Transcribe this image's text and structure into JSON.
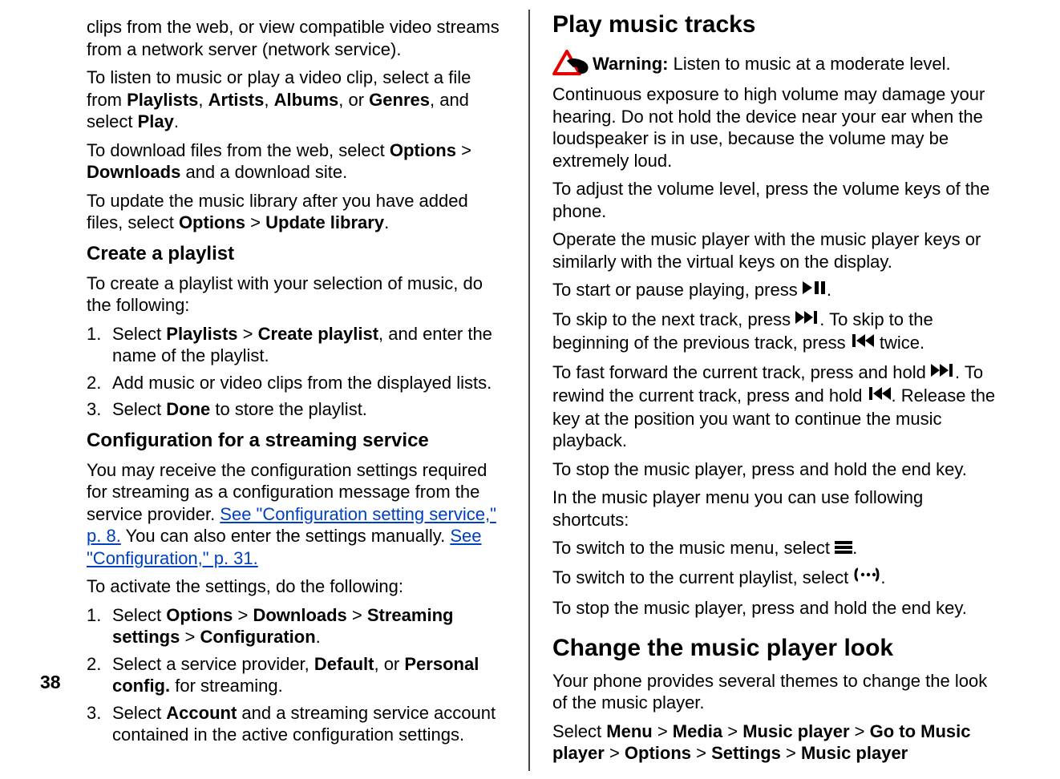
{
  "page_number": "38",
  "left": {
    "intro": "clips from the web, or view compatible video streams from a network server (network service).",
    "listen_prefix": "To listen to music or play a video clip, select a file from ",
    "playlists": "Playlists",
    "comma1": ", ",
    "artists": "Artists",
    "comma2": ", ",
    "albums": "Albums",
    "comma3": ", or ",
    "genres": "Genres",
    "listen_suffix1": ", and select ",
    "play": "Play",
    "period": ".",
    "download_prefix": "To download files from the web, select ",
    "options": "Options",
    "gt": " > ",
    "downloads": "Downloads",
    "download_suffix": " and a download site.",
    "update_prefix": "To update the music library after you have added files, select ",
    "update_library": "Update library",
    "h_create": "Create a playlist",
    "create_intro": "To create a playlist with your selection of music, do the following:",
    "li1_num": "1.",
    "li1_select": "Select ",
    "li1_create_playlist": "Create playlist",
    "li1_suffix": ", and enter the name of the playlist.",
    "li2_num": "2.",
    "li2": "Add music or video clips from the displayed lists.",
    "li3_num": "3.",
    "li3_select": "Select ",
    "li3_done": "Done",
    "li3_suffix": " to store the playlist.",
    "h_config": "Configuration for a streaming service",
    "config_p1_pre": "You may receive the configuration settings required for streaming as a configuration message from the service provider. ",
    "config_link1": "See \"Configuration setting service,\" p. 8.",
    "config_p1_mid": " You can also enter the settings manually. ",
    "config_link2": "See \"Configuration,\" p. 31.",
    "activate_intro": "To activate the settings, do the following:",
    "a_li1_num": "1.",
    "a_li1_select": "Select ",
    "a_li1_streaming": "Streaming settings",
    "a_li1_configuration": "Configuration",
    "a_li2_num": "2.",
    "a_li2_pre": "Select a service provider, ",
    "a_li2_default": "Default",
    "a_li2_or": ", or ",
    "a_li2_personal": "Personal config.",
    "a_li2_suffix": " for streaming.",
    "a_li3_num": "3.",
    "a_li3_select": "Select ",
    "a_li3_account": "Account",
    "a_li3_suffix": " and a streaming service account contained in the active configuration settings."
  },
  "right": {
    "h_play": "Play music tracks",
    "warning_label": "Warning:",
    "warning_text": "  Listen to music at a moderate level. Continuous exposure to high volume may damage your hearing. Do not hold the device near your ear when the loudspeaker is in use, because the volume may be extremely loud.",
    "adjust_vol": "To adjust the volume level, press the volume keys of the phone.",
    "operate": "Operate the music player with the music player keys or similarly with the virtual keys on the display.",
    "start_pause_pre": "To start or pause playing, press ",
    "start_pause_suf": ".",
    "skip_next_pre": "To skip to the next track, press ",
    "skip_next_mid": ". To skip to the beginning of the previous track, press ",
    "skip_next_suf": " twice.",
    "ff_pre": "To fast forward the current track, press and hold ",
    "ff_mid": ". To rewind the current track, press and hold ",
    "ff_suf": ". Release the key at the position you want to continue the music playback.",
    "stop1": "To stop the music player, press and hold the end key.",
    "shortcuts": "In the music player menu you can use following shortcuts:",
    "switch_menu_pre": "To switch to the music menu, select ",
    "switch_menu_suf": ".",
    "switch_playlist_pre": "To switch to the current playlist, select ",
    "switch_playlist_suf": ".",
    "stop2": "To stop the music player, press and hold the end key.",
    "h_change": "Change the music player look",
    "change_p1": "Your phone provides several themes to change the look of the music player.",
    "change_p2_select": "Select ",
    "change_p2_menu": "Menu",
    "change_p2_media": "Media",
    "change_p2_musicplayer": "Music player",
    "change_p2_go": "Go to Music player",
    "change_p2_settings": "Settings",
    "change_p2_mp2": "Music player"
  }
}
